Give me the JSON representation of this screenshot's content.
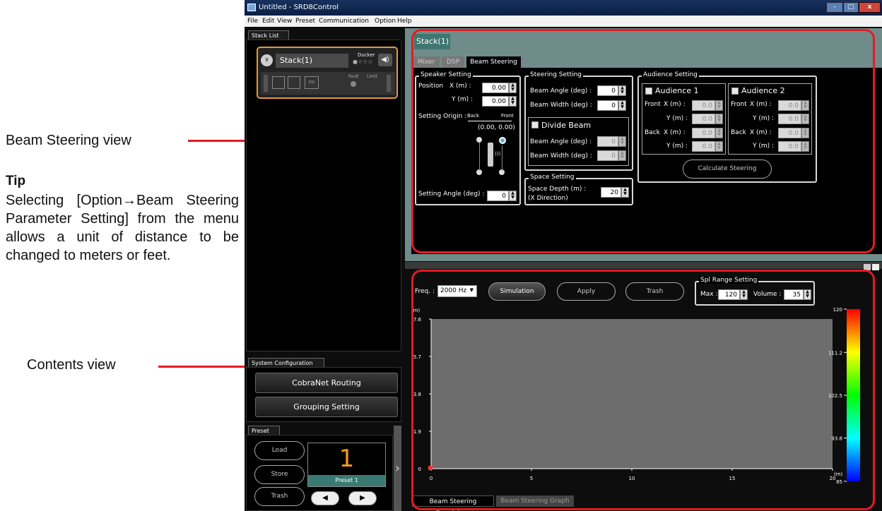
{
  "annotations": {
    "beam_steering_view": "Beam Steering view",
    "tip_title": "Tip",
    "tip_body": "Selecting [Option→Beam Steering Parameter Setting] from the menu allows a unit of distance to be changed to meters or feet.",
    "contents_view": "Contents view"
  },
  "window": {
    "title": "Untitled - SRD8Control",
    "controls": [
      "–",
      "□",
      "x"
    ]
  },
  "menu": [
    "File",
    "Edit",
    "View",
    "Preset",
    "Communication",
    "Option",
    "Help"
  ],
  "stack_list": {
    "tab": "Stack List",
    "stack_name": "Stack(1)",
    "ducker": "Ducker",
    "fault": "Fault",
    "limit": "Limit"
  },
  "system": {
    "tab": "System Configuration",
    "cobranet": "CobraNet Routing",
    "grouping": "Grouping Setting"
  },
  "preset": {
    "tab": "Preset",
    "load": "Load",
    "store": "Store",
    "trash": "Trash",
    "number": "1",
    "name": "Preset 1"
  },
  "beam": {
    "title": "Stack(1)",
    "tabs": [
      "Mixer",
      "DSP",
      "Beam Steering"
    ],
    "speaker": {
      "group": "Speaker Setting",
      "position": "Position",
      "x_label": "X (m) :",
      "x_value": "0.00",
      "y_label": "Y (m) :",
      "y_value": "0.00",
      "origin": "Setting Origin :",
      "back": "Back",
      "front": "Front",
      "coords": "(0.00, 0.00)",
      "angle_label": "Setting Angle (deg) :",
      "angle_value": "0"
    },
    "steering": {
      "group": "Steering Setting",
      "beam_angle": "Beam Angle (deg) :",
      "beam_angle_value": "0",
      "beam_width": "Beam Width (deg) :",
      "beam_width_value": "0",
      "divide": "Divide Beam",
      "d_angle_value": "0",
      "d_width_value": "0"
    },
    "space": {
      "group": "Space Setting",
      "depth": "Space Depth (m) :",
      "direction": "(X Direction)",
      "value": "20"
    },
    "audience": {
      "group": "Audience Setting",
      "a1": "Audience 1",
      "a2": "Audience 2",
      "front": "Front",
      "back": "Back",
      "x": "X (m) :",
      "y": "Y (m) :",
      "value": "0.0",
      "calculate": "Calculate Steering"
    }
  },
  "sim": {
    "freq_label": "Freq. :",
    "freq_value": "2000 Hz",
    "simulation": "Simulation",
    "apply": "Apply",
    "trash": "Trash",
    "spl": {
      "group": "Spl Range Setting",
      "max_label": "Max :",
      "max_value": "120",
      "volume_label": "Volume :",
      "volume_value": "35"
    },
    "y_unit": "(m)",
    "x_unit": "(m)",
    "tabs": [
      "Beam Steering Simulation",
      "Beam Steering Graph"
    ]
  },
  "chart_data": {
    "type": "heatmap",
    "y_ticks": [
      "7.6",
      "5.7",
      "3.8",
      "1.9",
      "0"
    ],
    "x_ticks": [
      "0",
      "5",
      "10",
      "15",
      "20"
    ],
    "xlim": [
      0,
      20
    ],
    "ylim": [
      0,
      7.6
    ],
    "xlabel": "(m)",
    "ylabel": "(m)",
    "colorbar_ticks": [
      "120",
      "111.2",
      "102.5",
      "93.8",
      "85"
    ],
    "colorbar_range": [
      85,
      120
    ],
    "colors": [
      "#ff0000",
      "#ffff00",
      "#00ff00",
      "#00ffff",
      "#0000ff"
    ],
    "plot_background": "#6d6d6d"
  }
}
